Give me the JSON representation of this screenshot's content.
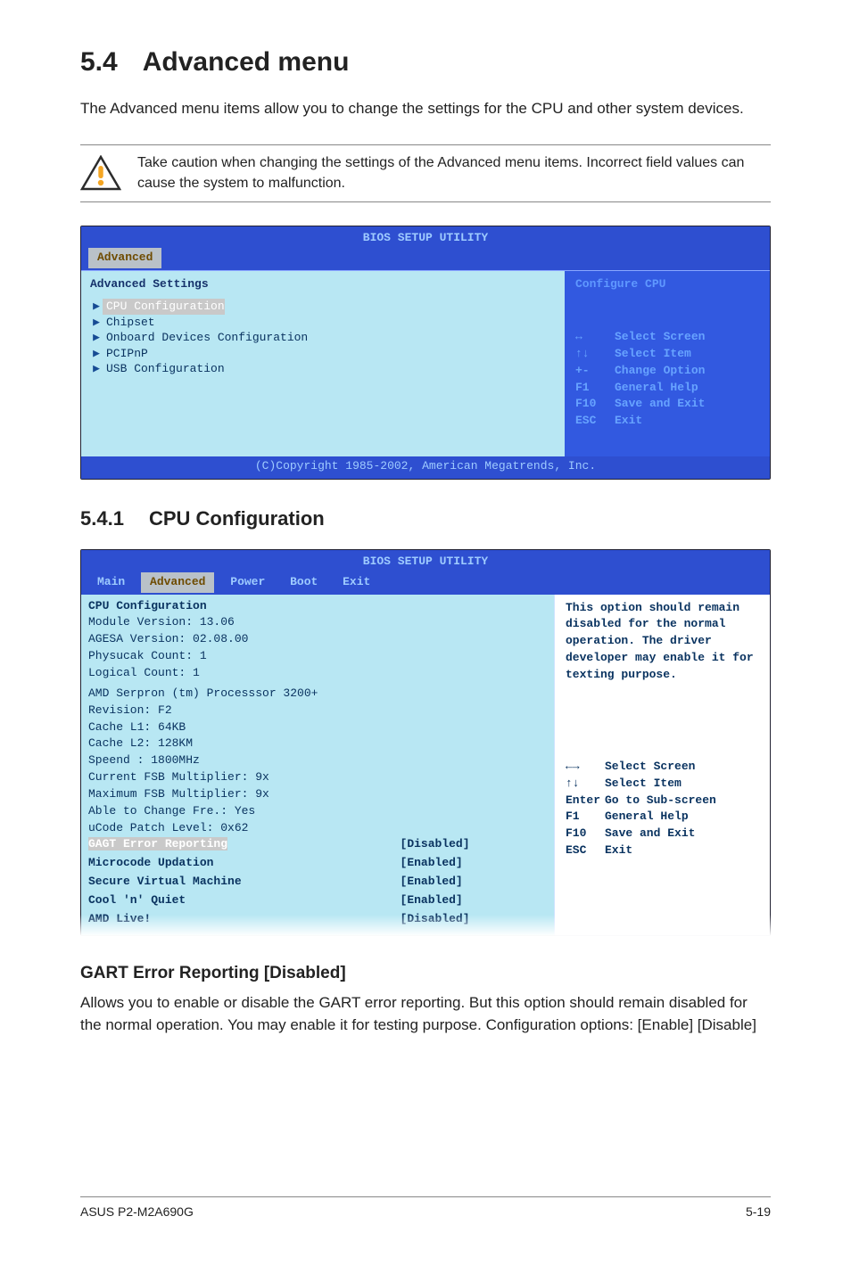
{
  "section": {
    "number": "5.4",
    "title": "Advanced menu",
    "intro": "The Advanced menu items allow you to change the settings for the CPU and other system devices.",
    "note": "Take caution when changing the settings of the Advanced menu items. Incorrect field values can cause the system to malfunction."
  },
  "bios1": {
    "title": "BIOS SETUP UTILITY",
    "tabs": [
      "Advanced"
    ],
    "header_line": "Advanced Settings",
    "menu_items": [
      "CPU Configuration",
      "Chipset",
      "Onboard Devices Configuration",
      "PCIPnP",
      "USB Configuration"
    ],
    "help_text": "Configure CPU",
    "keys": [
      {
        "k": "↔",
        "d": "Select Screen"
      },
      {
        "k": "↑↓",
        "d": "Select Item"
      },
      {
        "k": "+-",
        "d": "Change Option"
      },
      {
        "k": "F1",
        "d": "General Help"
      },
      {
        "k": "F10",
        "d": "Save and Exit"
      },
      {
        "k": "ESC",
        "d": "Exit"
      }
    ],
    "copyright": "(C)Copyright 1985-2002, American Megatrends, Inc."
  },
  "subsection": {
    "number": "5.4.1",
    "title": "CPU Configuration"
  },
  "bios2": {
    "title": "BIOS SETUP UTILITY",
    "tabs": [
      "Main",
      "Advanced",
      "Power",
      "Boot",
      "Exit"
    ],
    "info_lines": [
      "CPU Configuration",
      "Module Version: 13.06",
      "AGESA Version: 02.08.00",
      "Physucak Count: 1",
      "Logical Count: 1",
      "AMD Serpron (tm) Processsor 3200+",
      "Revision: F2",
      "Cache L1: 64KB",
      "Cache L2: 128KM",
      "Speend  : 1800MHz",
      "Current FSB Multiplier: 9x",
      "Maximum FSB Multiplier: 9x",
      "Able to Change Fre.: Yes",
      "uCode Patch Level: 0x62"
    ],
    "settings": [
      {
        "label": "GAGT Error Reporting",
        "value": "[Disabled]",
        "active": true
      },
      {
        "label": "Microcode Updation",
        "value": "[Enabled]"
      },
      {
        "label": "Secure Virtual Machine",
        "value": "[Enabled]"
      },
      {
        "label": "Cool 'n' Quiet",
        "value": "[Enabled]"
      },
      {
        "label": "AMD Live!",
        "value": "[Disabled]"
      }
    ],
    "help_text": "This option should remain disabled for the normal operation. The driver developer may enable it for texting purpose.",
    "keys": [
      {
        "k": "←→",
        "d": "Select Screen"
      },
      {
        "k": "↑↓",
        "d": "Select Item"
      },
      {
        "k": "Enter",
        "d": "Go to Sub-screen"
      },
      {
        "k": "F1",
        "d": "General Help"
      },
      {
        "k": "F10",
        "d": "Save and Exit"
      },
      {
        "k": "ESC",
        "d": "Exit"
      }
    ]
  },
  "item": {
    "title": "GART Error Reporting [Disabled]",
    "body": "Allows you to enable or disable the GART error reporting. But this option should remain disabled for the normal operation. You may enable it for testing purpose. Configuration options: [Enable] [Disable]"
  },
  "footer": {
    "left": "ASUS P2-M2A690G",
    "right": "5-19"
  }
}
